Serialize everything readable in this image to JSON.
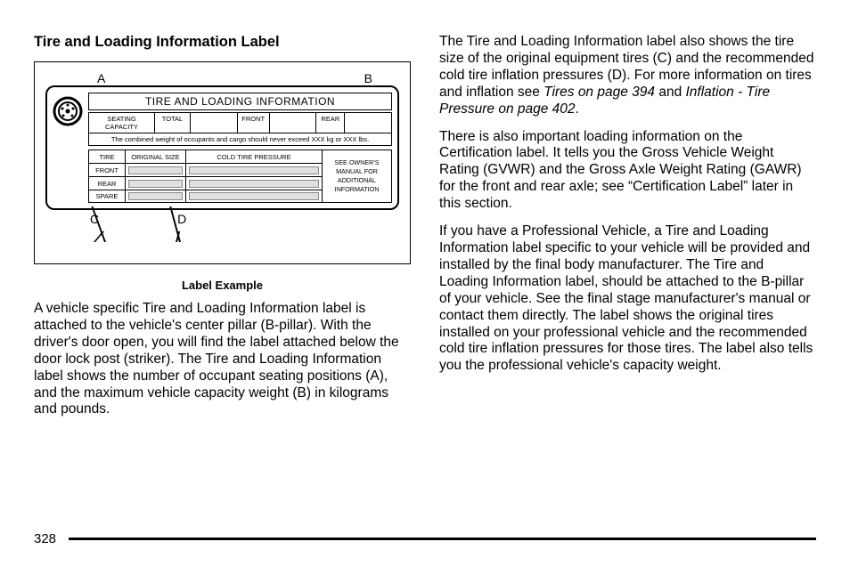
{
  "section_title": "Tire and Loading Information Label",
  "figure": {
    "callout_A": "A",
    "callout_B": "B",
    "callout_C": "C",
    "callout_D": "D",
    "placard_title": "TIRE AND LOADING INFORMATION",
    "seating": {
      "label": "SEATING CAPACITY",
      "total_label": "TOTAL",
      "front_label": "FRONT",
      "rear_label": "REAR"
    },
    "weight_note": "The combined weight of occupants and cargo should never exceed  XXX kg or XXX lbs.",
    "tire_headers": {
      "tire": "TIRE",
      "original_size": "ORIGINAL SIZE",
      "cold_pressure": "COLD TIRE PRESSURE"
    },
    "tire_rows": [
      "FRONT",
      "REAR",
      "SPARE"
    ],
    "owner_note": [
      "SEE OWNER'S",
      "MANUAL FOR",
      "ADDITIONAL",
      "INFORMATION"
    ]
  },
  "caption": "Label Example",
  "left_p1": "A vehicle specific Tire and Loading Information label is attached to the vehicle's center pillar (B-pillar). With the driver's door open, you will find the label attached below the door lock post (striker). The Tire and Loading Information label shows the number of occupant seating positions (A), and the maximum vehicle capacity weight (B) in kilograms and pounds.",
  "right_p1_a": "The Tire and Loading Information label also shows the tire size of the original equipment tires (C) and the recommended cold tire inflation pressures (D). For more information on tires and inflation see ",
  "right_p1_ital1": "Tires on page 394",
  "right_p1_b": " and ",
  "right_p1_ital2": "Inflation - Tire Pressure on page 402",
  "right_p1_c": ".",
  "right_p2": "There is also important loading information on the Certification label. It tells you the Gross Vehicle Weight Rating (GVWR) and the Gross Axle Weight Rating (GAWR) for the front and rear axle; see “Certification Label” later in this section.",
  "right_p3": "If you have a Professional Vehicle, a Tire and Loading Information label specific to your vehicle will be provided and installed by the final body manufacturer. The Tire and Loading Information label, should be attached to the B-pillar of your vehicle. See the final stage manufacturer's manual or contact them directly. The label shows the original tires installed on your professional vehicle and the recommended cold tire inflation pressures for those tires. The label also tells you the professional vehicle's capacity weight.",
  "page_number": "328"
}
